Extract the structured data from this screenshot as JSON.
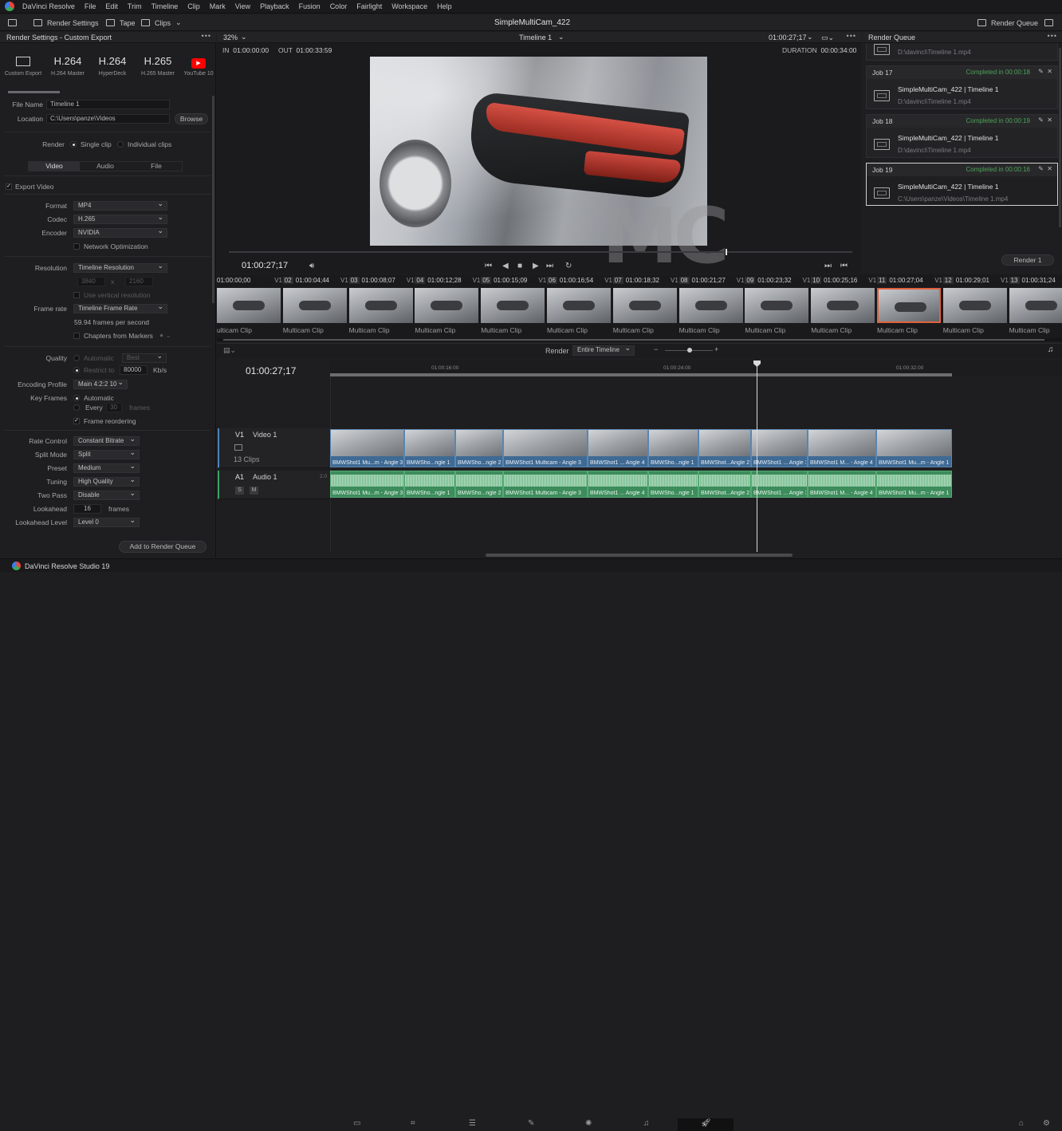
{
  "menu": {
    "app": "DaVinci Resolve",
    "items": [
      "File",
      "Edit",
      "Trim",
      "Timeline",
      "Clip",
      "Mark",
      "View",
      "Playback",
      "Fusion",
      "Color",
      "Fairlight",
      "Workspace",
      "Help"
    ]
  },
  "toolbar": {
    "render_settings": "Render Settings",
    "tape": "Tape",
    "clips": "Clips",
    "project": "SimpleMultiCam_422",
    "render_queue": "Render Queue"
  },
  "left": {
    "title": "Render Settings - Custom Export",
    "presets": [
      {
        "big": "",
        "small": "Custom Export"
      },
      {
        "big": "H.264",
        "small": "H.264 Master"
      },
      {
        "big": "H.264",
        "small": "HyperDeck"
      },
      {
        "big": "H.265",
        "small": "H.265 Master"
      },
      {
        "big": "",
        "small": "YouTube 10"
      }
    ],
    "file_name_label": "File Name",
    "file_name": "Timeline 1",
    "location_label": "Location",
    "location": "C:\\Users\\panze\\Videos",
    "browse": "Browse",
    "render_label": "Render",
    "single_clip": "Single clip",
    "individual_clips": "Individual clips",
    "tabs": [
      "Video",
      "Audio",
      "File"
    ],
    "export_video": "Export Video",
    "format_label": "Format",
    "format": "MP4",
    "codec_label": "Codec",
    "codec": "H.265",
    "encoder_label": "Encoder",
    "encoder": "NVIDIA",
    "network_opt": "Network Optimization",
    "resolution_label": "Resolution",
    "resolution": "Timeline Resolution",
    "res_w": "3840",
    "res_x": "x",
    "res_h": "2160",
    "vertical_res": "Use vertical resolution",
    "frame_rate_label": "Frame rate",
    "frame_rate": "Timeline Frame Rate",
    "fps_text": "59.94 frames per second",
    "chapters": "Chapters from Markers",
    "quality_label": "Quality",
    "quality_auto": "Automatic",
    "quality_best": "Best",
    "restrict_to": "Restrict to",
    "bitrate": "80000",
    "kbs": "Kb/s",
    "enc_profile_label": "Encoding Profile",
    "enc_profile": "Main 4:2:2 10",
    "key_frames_label": "Key Frames",
    "kf_auto": "Automatic",
    "kf_every": "Every",
    "kf_val": "30",
    "kf_frames": "frames",
    "frame_reorder": "Frame reordering",
    "rate_control_label": "Rate Control",
    "rate_control": "Constant Bitrate",
    "split_mode_label": "Split Mode",
    "split_mode": "Split",
    "preset_label": "Preset",
    "preset": "Medium",
    "tuning_label": "Tuning",
    "tuning": "High Quality",
    "two_pass_label": "Two Pass",
    "two_pass": "Disable",
    "lookahead_label": "Lookahead",
    "lookahead": "16",
    "lookahead_unit": "frames",
    "lookahead_level_label": "Lookahead Level",
    "lookahead_level": "Level 0",
    "add_btn": "Add to Render Queue"
  },
  "viewer": {
    "zoom": "32%",
    "timeline": "Timeline 1",
    "tc_top": "01:00:27;17",
    "in_label": "IN",
    "in": "01:00:00:00",
    "out_label": "OUT",
    "out": "01:00:33:59",
    "duration_label": "DURATION",
    "duration": "00:00:34:00",
    "timecode": "01:00:27;17",
    "watermark": "MC"
  },
  "queue": {
    "title": "Render Queue",
    "top_path": "D:\\davinci\\Timeline 1.mp4",
    "jobs": [
      {
        "id": "Job 17",
        "status": "Completed in 00:00:18",
        "name": "SimpleMultiCam_422 | Timeline 1",
        "path": "D:\\davinci\\Timeline 1.mp4"
      },
      {
        "id": "Job 18",
        "status": "Completed in 00:00:19",
        "name": "SimpleMultiCam_422 | Timeline 1",
        "path": "D:\\davinci\\Timeline 1.mp4"
      },
      {
        "id": "Job 19",
        "status": "Completed in 00:00:16",
        "name": "SimpleMultiCam_422 | Timeline 1",
        "path": "C:\\Users\\panze\\Videos\\Timeline 1.mp4"
      }
    ],
    "render_btn": "Render 1"
  },
  "clips": [
    {
      "num": "",
      "tc": "01:00:00;00",
      "track": "V1",
      "name": "ulticam Clip"
    },
    {
      "num": "02",
      "tc": "01:00:04;44",
      "track": "V1",
      "name": "Multicam Clip"
    },
    {
      "num": "03",
      "tc": "01:00:08;07",
      "track": "V1",
      "name": "Multicam Clip"
    },
    {
      "num": "04",
      "tc": "01:00:12;28",
      "track": "V1",
      "name": "Multicam Clip"
    },
    {
      "num": "05",
      "tc": "01:00:15;09",
      "track": "V1",
      "name": "Multicam Clip"
    },
    {
      "num": "06",
      "tc": "01:00:16;54",
      "track": "V1",
      "name": "Multicam Clip"
    },
    {
      "num": "07",
      "tc": "01:00:18;32",
      "track": "V1",
      "name": "Multicam Clip"
    },
    {
      "num": "08",
      "tc": "01:00:21;27",
      "track": "V1",
      "name": "Multicam Clip"
    },
    {
      "num": "09",
      "tc": "01:00:23;32",
      "track": "V1",
      "name": "Multicam Clip"
    },
    {
      "num": "10",
      "tc": "01:00:25;16",
      "track": "V1",
      "name": "Multicam Clip"
    },
    {
      "num": "11",
      "tc": "01:00:27;04",
      "track": "V1",
      "name": "Multicam Clip"
    },
    {
      "num": "12",
      "tc": "01:00:29;01",
      "track": "V1",
      "name": "Multicam Clip"
    },
    {
      "num": "13",
      "tc": "01:00:31;24",
      "track": "V1",
      "name": "Multicam Clip"
    }
  ],
  "timeline": {
    "render_label": "Render",
    "render_range": "Entire Timeline",
    "timecode": "01:00:27;17",
    "ruler": [
      "01:00:16:00",
      "01:00:24:00",
      "01:00:32:00"
    ],
    "v1": "V1",
    "v1_name": "Video 1",
    "v1_count": "13 Clips",
    "a1": "A1",
    "a1_name": "Audio 1",
    "a1_ch": "2.0",
    "solo": "S",
    "mute": "M",
    "vclips": [
      "BMWShot1 Mu...m - Angle 3",
      "BMWSho...ngle 1",
      "BMWSho...ngle 2",
      "BMWShot1 Multicam - Angle 3",
      "BMWShot1 ... Angle 4",
      "BMWSho...ngle 1",
      "BMWShot...Angle 2",
      "BMWShot1 ... Angle 3",
      "BMWShot1 M... - Angle 4",
      "BMWShot1 Mu...m - Angle 1"
    ],
    "aclips": [
      "BMWShot1 Mu...m - Angle 3",
      "BMWSho...ngle 1",
      "BMWSho...ngle 2",
      "BMWShot1 Multicam - Angle 3",
      "BMWShot1 ... Angle 4",
      "BMWSho...ngle 1",
      "BMWShot...Angle 2",
      "BMWShot1 ... Angle 3",
      "BMWShot1 M... - Angle 4",
      "BMWShot1 Mu...m - Angle 1"
    ]
  },
  "status": {
    "app_name": "DaVinci Resolve Studio 19"
  }
}
